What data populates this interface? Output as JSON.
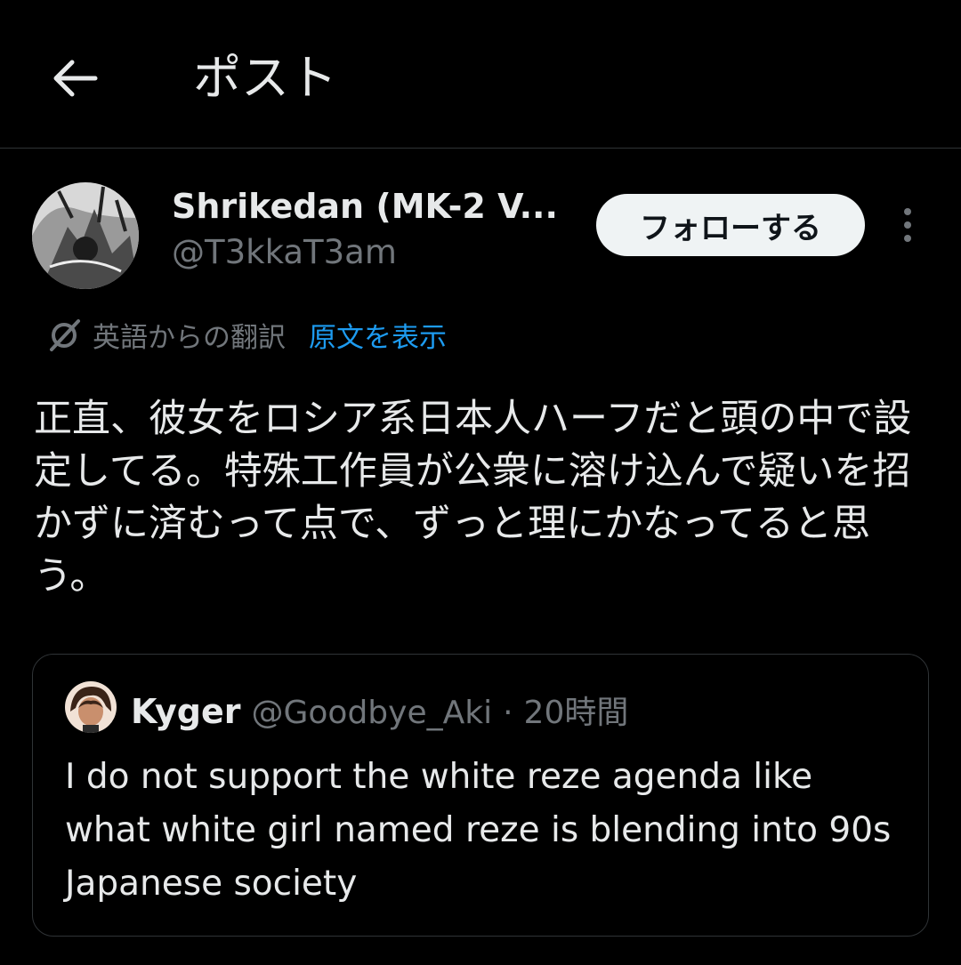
{
  "header": {
    "title": "ポスト"
  },
  "author": {
    "display_name": "Shrikedan (MK-2 V...",
    "handle": "@T3kkaT3am"
  },
  "follow_button_label": "フォローする",
  "translation": {
    "label": "英語からの翻訳",
    "show_original": "原文を表示"
  },
  "post": {
    "text": "正直、彼女をロシア系日本人ハーフだと頭の中で設定してる。特殊工作員が公衆に溶け込んで疑いを招かずに済むって点で、ずっと理にかなってると思う。"
  },
  "quote": {
    "name": "Kyger",
    "handle": "@Goodbye_Aki",
    "separator": "·",
    "time": "20時間",
    "text": "I do not support the white reze agenda like what white girl named reze is blending into 90s Japanese society"
  },
  "colors": {
    "background": "#000000",
    "text": "#e7e9ea",
    "secondary": "#71767b",
    "link": "#1d9bf0",
    "border": "#2f3336"
  }
}
